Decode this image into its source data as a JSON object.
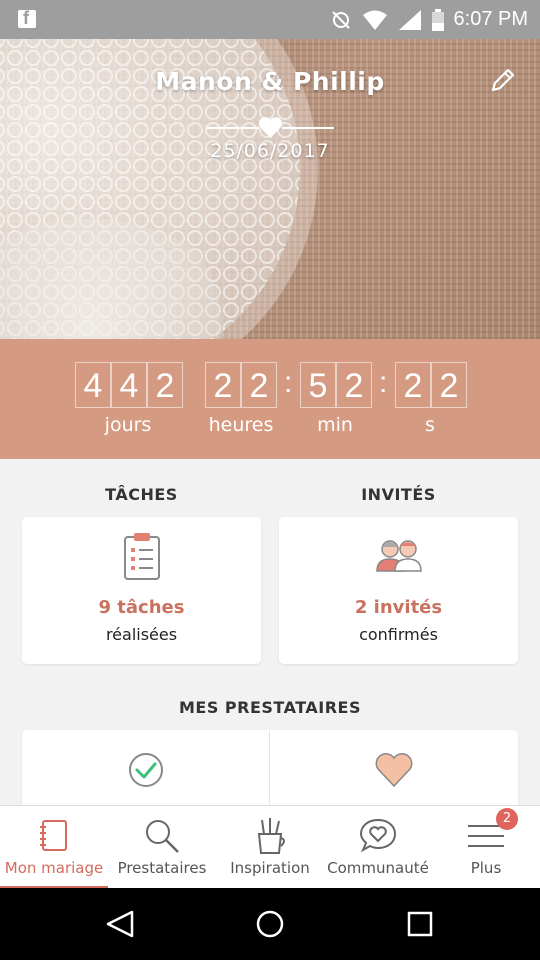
{
  "status_bar": {
    "time": "6:07 PM",
    "icons": [
      "facebook-icon",
      "no-sync-icon",
      "wifi-icon",
      "signal-icon",
      "battery-icon"
    ]
  },
  "header": {
    "couple_names": "Manon & Phillip",
    "wedding_date": "25/06/2017"
  },
  "countdown": {
    "days_digits": [
      "4",
      "4",
      "2"
    ],
    "hours_digits": [
      "2",
      "2"
    ],
    "minutes_digits": [
      "5",
      "2"
    ],
    "seconds_digits": [
      "2",
      "2"
    ],
    "separator": ":",
    "labels": {
      "days": "jours",
      "hours": "heures",
      "minutes": "min",
      "seconds": "s"
    }
  },
  "tasks": {
    "title": "TÂCHES",
    "count": "9 tâches",
    "subtitle": "réalisées"
  },
  "guests": {
    "title": "INVITÉS",
    "count": "2 invités",
    "subtitle": "confirmés"
  },
  "vendors": {
    "title": "MES PRESTATAIRES"
  },
  "bottom_nav": {
    "items": [
      {
        "label": "Mon mariage",
        "icon": "notebook-icon",
        "active": true
      },
      {
        "label": "Prestataires",
        "icon": "search-icon",
        "active": false
      },
      {
        "label": "Inspiration",
        "icon": "brushes-cup-icon",
        "active": false
      },
      {
        "label": "Communauté",
        "icon": "heart-chat-icon",
        "active": false
      },
      {
        "label": "Plus",
        "icon": "menu-icon",
        "active": false,
        "badge": "2"
      }
    ]
  },
  "colors": {
    "accent": "#d56a5d",
    "countdown_bg": "#d59a82",
    "count_text": "#c9725f"
  }
}
